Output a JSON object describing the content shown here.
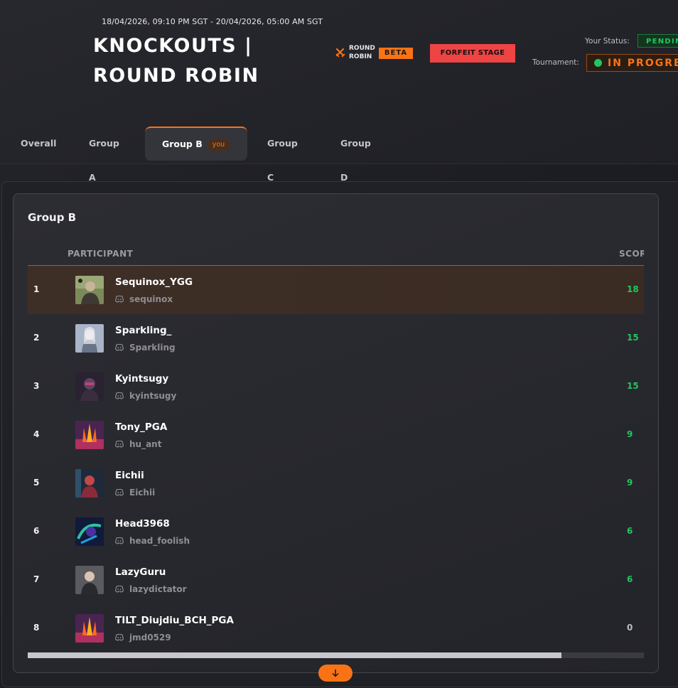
{
  "header": {
    "date_range": "18/04/2026, 09:10 PM SGT - 20/04/2026, 05:00 AM SGT",
    "title": "KNOCKOUTS | ROUND ROBIN",
    "format_line1": "ROUND",
    "format_line2": "ROBIN",
    "beta_label": "BETA",
    "forfeit_label": "FORFEIT STAGE",
    "your_status_label": "Your Status:",
    "your_status_value": "PENDING",
    "tournament_label": "Tournament:",
    "tournament_value": "IN PROGRESS"
  },
  "tabs": [
    {
      "label": "Overall"
    },
    {
      "label": "Group A"
    },
    {
      "label": "Group B",
      "badge": "you"
    },
    {
      "label": "Group C"
    },
    {
      "label": "Group D"
    }
  ],
  "active_tab": "Group B",
  "table": {
    "title": "Group B",
    "col_participant": "PARTICIPANT",
    "col_score": "SCORE",
    "rows": [
      {
        "rank": "1",
        "name": "Sequinox_YGG",
        "discord": "sequinox",
        "score": "18",
        "avatar": "avatar-1"
      },
      {
        "rank": "2",
        "name": "Sparkling_",
        "discord": "Sparkling",
        "score": "15",
        "avatar": "avatar-2"
      },
      {
        "rank": "3",
        "name": "Kyintsugy",
        "discord": "kyintsugy",
        "score": "15",
        "avatar": "avatar-3"
      },
      {
        "rank": "4",
        "name": "Tony_PGA",
        "discord": "hu_ant",
        "score": "9",
        "avatar": "avatar-4"
      },
      {
        "rank": "5",
        "name": "Eichii",
        "discord": "Eichii",
        "score": "9",
        "avatar": "avatar-5"
      },
      {
        "rank": "6",
        "name": "Head3968",
        "discord": "head_foolish",
        "score": "6",
        "avatar": "avatar-6"
      },
      {
        "rank": "7",
        "name": "LazyGuru",
        "discord": "lazydictator",
        "score": "6",
        "avatar": "avatar-7"
      },
      {
        "rank": "8",
        "name": "TILT_Diujdiu_BCH_PGA",
        "discord": "jmd0529",
        "score": "0",
        "avatar": "avatar-8"
      }
    ]
  },
  "colors": {
    "accent": "#f97316",
    "score_positive": "#22c55e",
    "score_zero": "#bdbdc2",
    "highlight_row": "#3e2f26"
  }
}
